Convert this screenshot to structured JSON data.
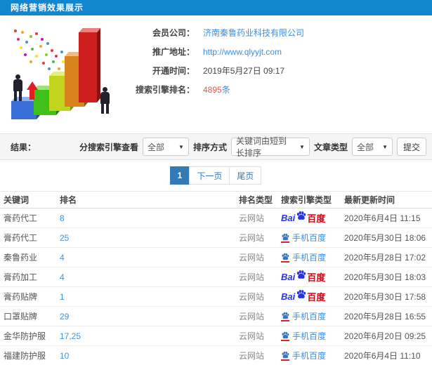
{
  "header": {
    "title": "网络营销效果展示"
  },
  "info": {
    "company_label": "会员公司：",
    "company_value": "济南秦鲁药业科技有限公司",
    "url_label": "推广地址：",
    "url_value": "http://www.qlyyjt.com",
    "time_label": "开通时间：",
    "time_value": "2019年5月27日 09:17",
    "rank_label": "搜索引擎排名：",
    "rank_value": "4895",
    "rank_unit": "条"
  },
  "filters": {
    "result_label": "结果：",
    "engine_label": "分搜索引擎查看",
    "engine_value": "全部",
    "sort_label": "排序方式",
    "sort_value": "关键词由短到长排序",
    "article_label": "文章类型",
    "article_value": "全部",
    "submit_label": "提交",
    "caret": "▼"
  },
  "pagination": {
    "current": "1",
    "next_label": "下一页",
    "last_label": "尾页"
  },
  "table": {
    "headers": [
      "关键词",
      "排名",
      "排名类型",
      "搜索引擎类型",
      "最新更新时间"
    ],
    "engine_labels": {
      "baidu_bai": "Bai",
      "baidu_du": "百度",
      "mobile": "手机百度"
    },
    "rows": [
      {
        "keyword": "膏药代工",
        "rank": "8",
        "rank_type": "云网站",
        "engine": "baidu",
        "updated": "2020年6月4日 11:15"
      },
      {
        "keyword": "膏药代工",
        "rank": "25",
        "rank_type": "云网站",
        "engine": "mobile-baidu",
        "updated": "2020年5月30日 18:06"
      },
      {
        "keyword": "秦鲁药业",
        "rank": "4",
        "rank_type": "云网站",
        "engine": "mobile-baidu",
        "updated": "2020年5月28日 17:02"
      },
      {
        "keyword": "膏药加工",
        "rank": "4",
        "rank_type": "云网站",
        "engine": "baidu",
        "updated": "2020年5月30日 18:03"
      },
      {
        "keyword": "膏药贴牌",
        "rank": "1",
        "rank_type": "云网站",
        "engine": "baidu",
        "updated": "2020年5月30日 17:58"
      },
      {
        "keyword": "口罩贴牌",
        "rank": "29",
        "rank_type": "云网站",
        "engine": "mobile-baidu",
        "updated": "2020年5月28日 16:55"
      },
      {
        "keyword": "金华防护服",
        "rank": "17,25",
        "rank_type": "云网站",
        "engine": "mobile-baidu",
        "updated": "2020年6月20日 09:25"
      },
      {
        "keyword": "福建防护服",
        "rank": "10",
        "rank_type": "云网站",
        "engine": "mobile-baidu",
        "updated": "2020年6月4日 11:10"
      }
    ]
  },
  "colors": {
    "header_bg": "#1386d0",
    "link_blue": "#3f8ede",
    "rank_red": "#e2574c",
    "baidu_blue": "#2932e1",
    "baidu_red": "#d6000f",
    "pager_active": "#337ab7"
  }
}
